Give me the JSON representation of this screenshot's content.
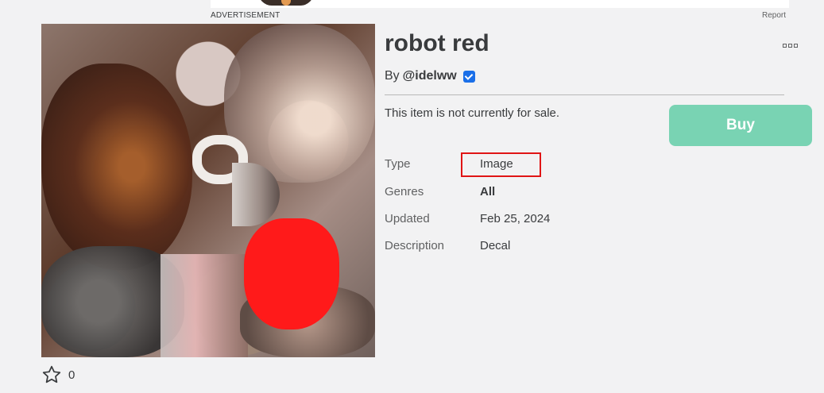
{
  "ad": {
    "label": "ADVERTISEMENT",
    "report_label": "Report"
  },
  "item": {
    "title": "robot red",
    "by_prefix": "By",
    "creator": "@idelww",
    "creator_verified": true,
    "sale_status": "This item is not currently for sale.",
    "buy_label": "Buy",
    "details": {
      "type_label": "Type",
      "type_value": "Image",
      "genres_label": "Genres",
      "genres_value": "All",
      "updated_label": "Updated",
      "updated_value": "Feb 25, 2024",
      "description_label": "Description",
      "description_value": "Decal"
    },
    "favorite_count": "0"
  },
  "colors": {
    "buy_button": "#79d3b3",
    "verified_badge": "#1a6fe8",
    "highlight_box": "#e01515",
    "background": "#f2f2f3"
  },
  "icons": {
    "more": "more-options-icon",
    "verified": "verified-badge-icon",
    "favorite": "star-outline-icon"
  }
}
